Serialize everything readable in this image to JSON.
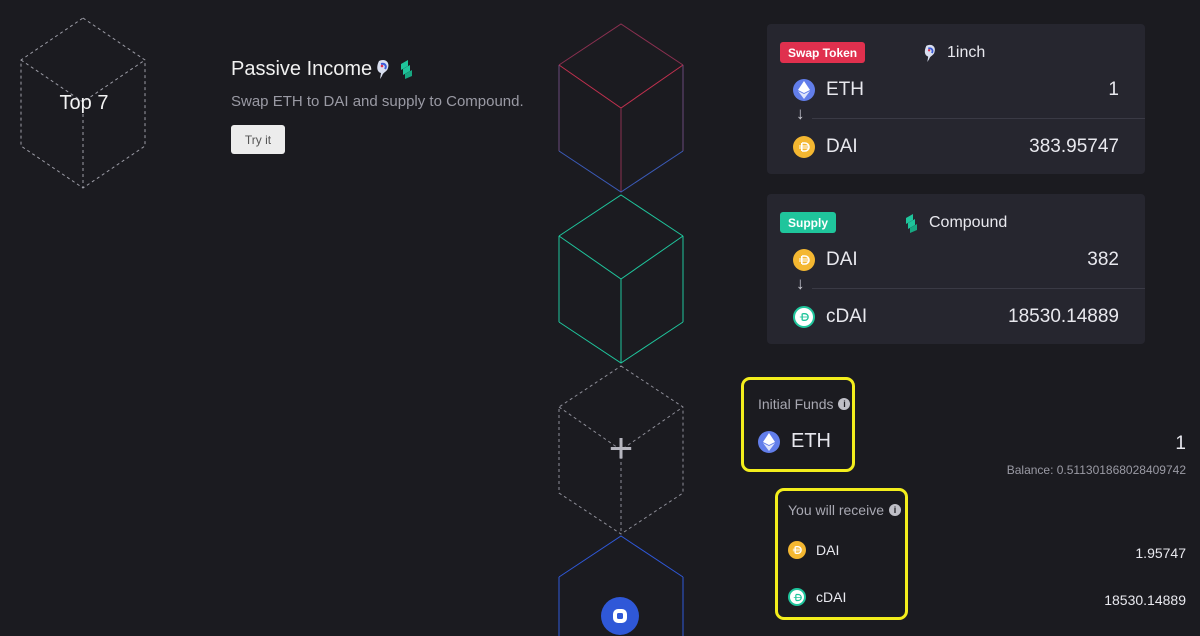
{
  "left": {
    "top_label": "Top 7"
  },
  "strategy": {
    "title": "Passive Income",
    "description": "Swap ETH to DAI and supply to Compound.",
    "try_button": "Try it",
    "icons": [
      "1inch-icon",
      "compound-icon"
    ]
  },
  "colors": {
    "swap_badge": "#e0304e",
    "supply_badge": "#1fc59c",
    "highlight": "#f3ee1c",
    "eth": "#627eea",
    "dai": "#f4b731",
    "compound": "#1fc59c",
    "cube_swap": "#c0304e",
    "cube_supply": "#1fc59c",
    "cube_bottom": "#2f58d8"
  },
  "cards": [
    {
      "badge": "Swap Token",
      "protocol": "1inch",
      "from": {
        "token": "ETH",
        "amount": "1",
        "icon": "eth-icon"
      },
      "to": {
        "token": "DAI",
        "amount": "383.95747",
        "icon": "dai-icon"
      }
    },
    {
      "badge": "Supply",
      "protocol": "Compound",
      "from": {
        "token": "DAI",
        "amount": "382",
        "icon": "dai-icon"
      },
      "to": {
        "token": "cDAI",
        "amount": "18530.14889",
        "icon": "cdai-icon"
      }
    }
  ],
  "arrow": "↓",
  "funds": {
    "label": "Initial Funds",
    "token": "ETH",
    "amount": "1",
    "balance": "Balance: 0.511301868028409742"
  },
  "receive": {
    "label": "You will receive",
    "items": [
      {
        "token": "DAI",
        "amount": "1.95747"
      },
      {
        "token": "cDAI",
        "amount": "18530.14889"
      }
    ]
  },
  "add_symbol": "+"
}
